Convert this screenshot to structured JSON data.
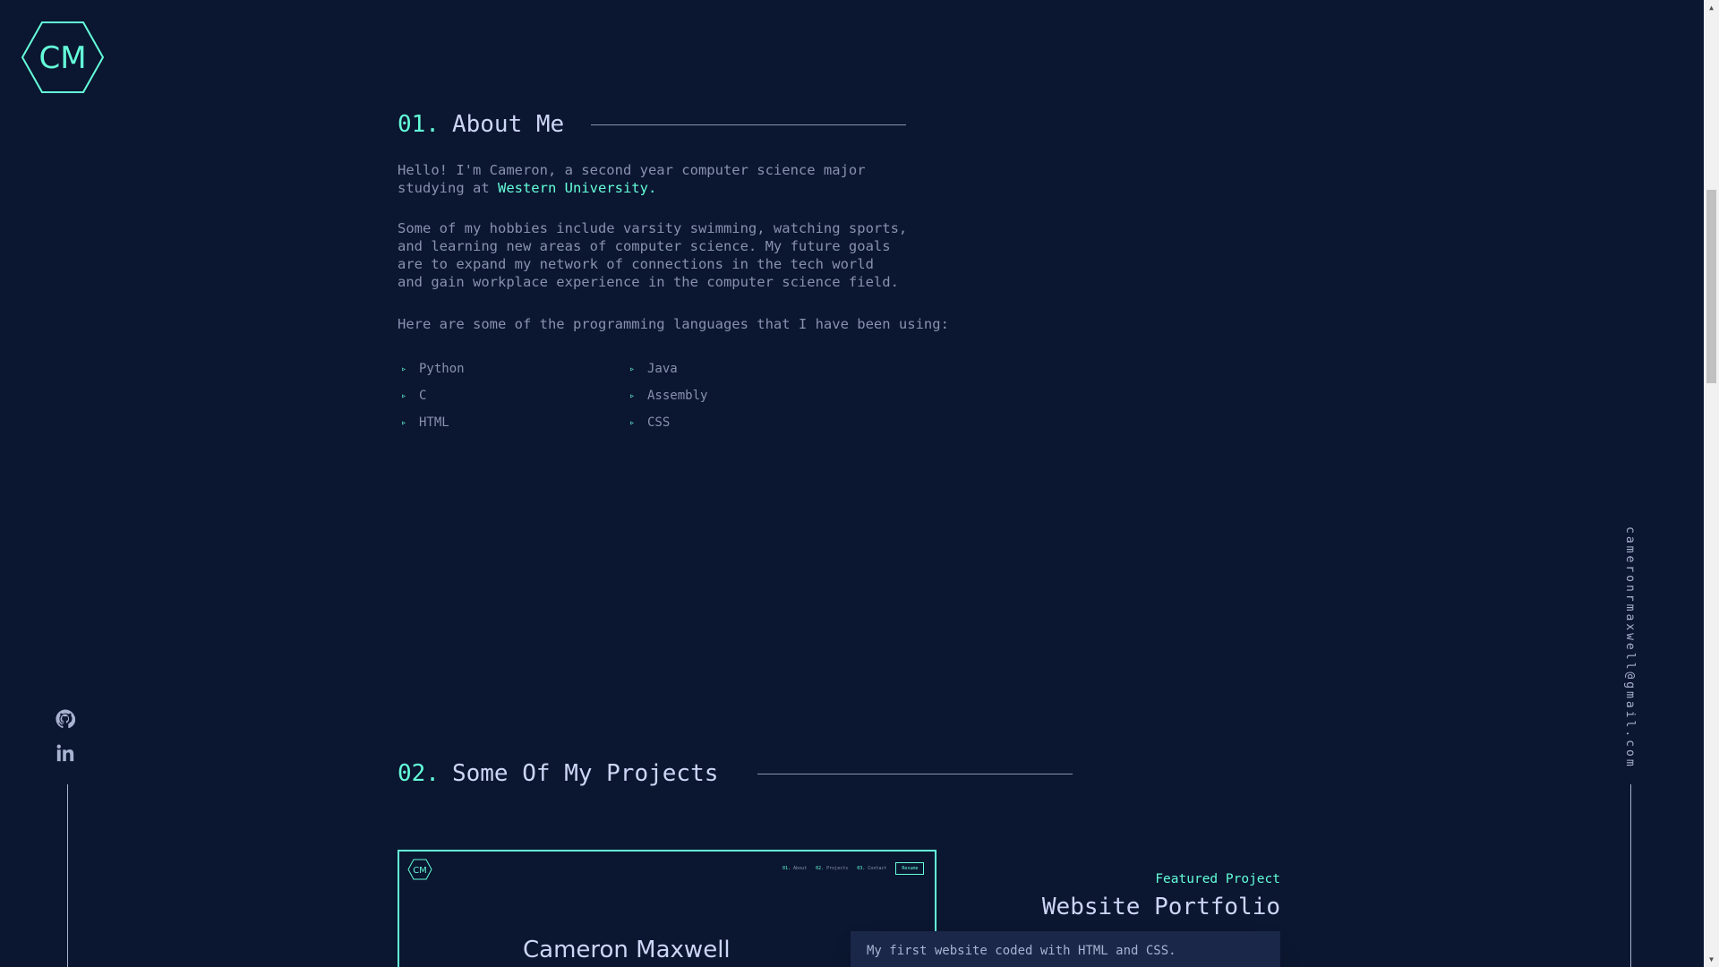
{
  "logo": {
    "text": "CM",
    "color": "#64ffda"
  },
  "social": {
    "icons": [
      "github-icon",
      "linkedin-icon"
    ]
  },
  "email": "cameronrmaxwell@gmail.com",
  "about": {
    "number": "01.",
    "title": "About Me",
    "p1_line1": "Hello! I'm Cameron, a second year computer science major",
    "p1_prefix": "studying at ",
    "p1_link": "Western University.",
    "p2": "Some of my hobbies include varsity swimming, watching sports,\nand learning new areas of computer science. My future goals\nare to expand my network of connections in the tech world\nand gain workplace experience in the computer science field.",
    "p3": "Here are some of the programming languages that I have been using:",
    "skills": [
      "Python",
      "Java",
      "C",
      "Assembly",
      "HTML",
      "CSS"
    ]
  },
  "projects": {
    "number": "02.",
    "title": "Some Of My Projects",
    "featured": {
      "overline": "Featured Project",
      "title": "Website Portfolio",
      "description": "My first website coded with HTML and CSS.",
      "preview": {
        "logo_text": "CM",
        "nav": [
          {
            "num": "01.",
            "label": "About"
          },
          {
            "num": "02.",
            "label": "Projects"
          },
          {
            "num": "03.",
            "label": "Contact"
          }
        ],
        "resume_label": "Resume",
        "title": "Cameron Maxwell"
      }
    }
  },
  "colors": {
    "background": "#0b1630",
    "accent": "#64ffda",
    "text": "#8892b0",
    "heading": "#ccd6f6"
  }
}
